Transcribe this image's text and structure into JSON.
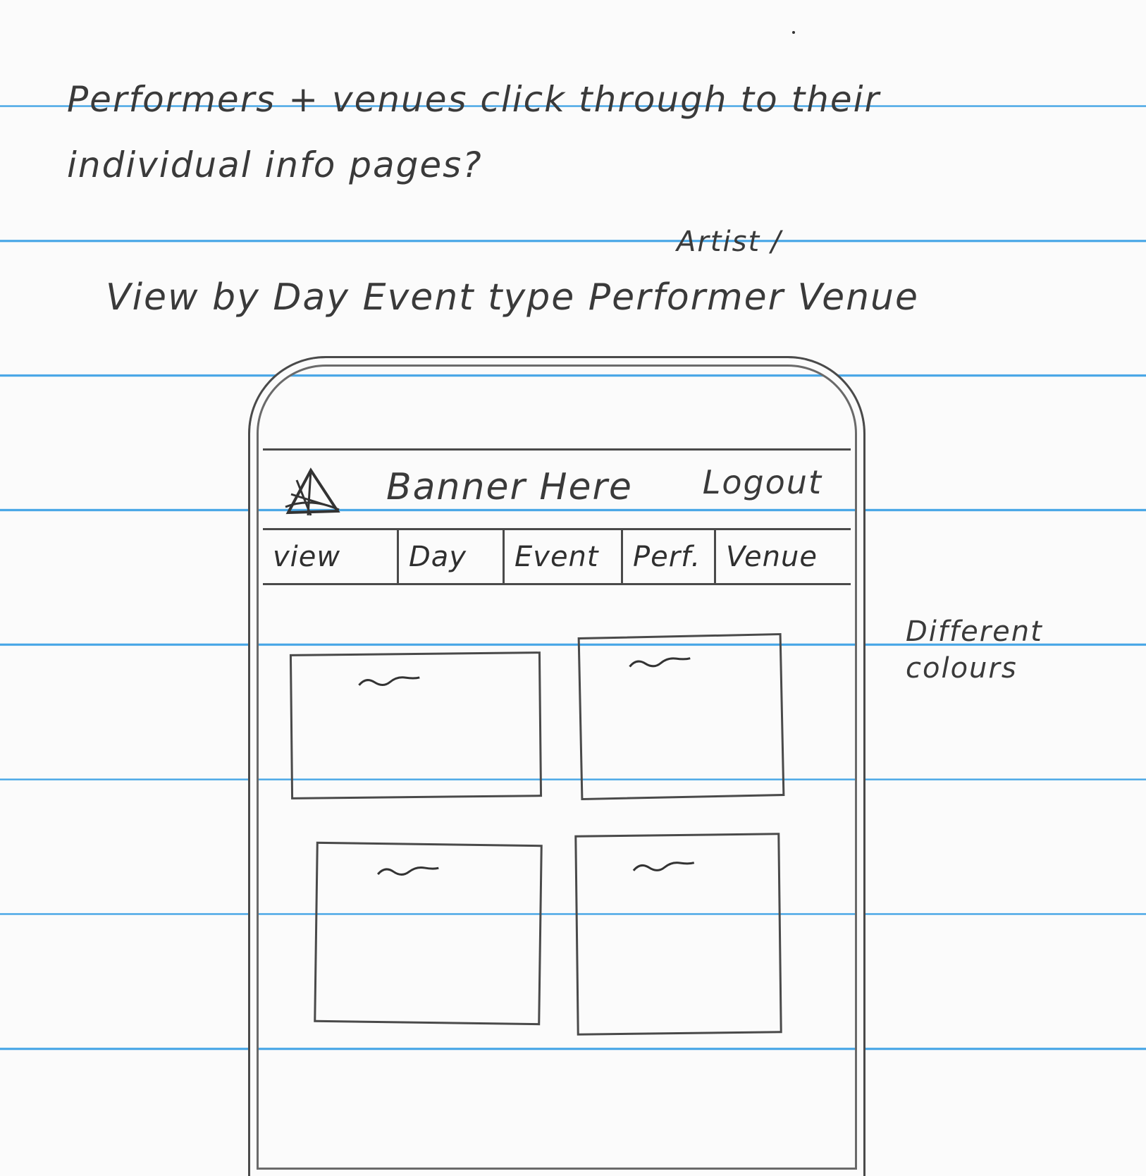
{
  "notes": {
    "line1": "Performers + venues click through to their",
    "line2": "individual info pages?",
    "artist_insert": "Artist /",
    "view_by": "View by  Day  Event type  Performer  Venue",
    "side_note": "Different\ncolours"
  },
  "header": {
    "logo_icon": "logo-icon",
    "banner": "Banner Here",
    "logout": "Logout"
  },
  "nav": {
    "items": [
      "view",
      "Day",
      "Event",
      "Perf.",
      "Venue"
    ]
  },
  "cards": {
    "count": 4,
    "placeholder_icon": "squiggle-text-placeholder"
  },
  "colors": {
    "page": "#fbfbfb",
    "rule_lines": "#47a6e6",
    "ink": "#3a3a3a"
  }
}
